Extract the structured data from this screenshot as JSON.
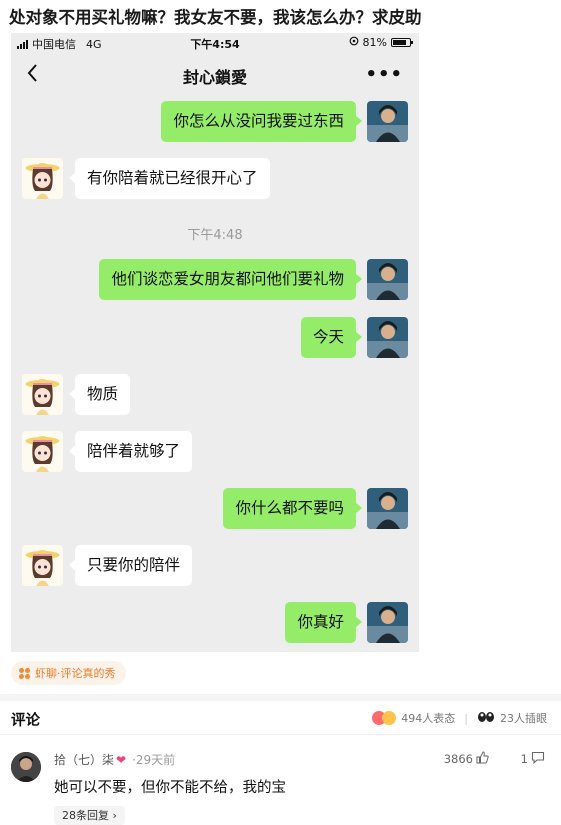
{
  "post": {
    "title": "处对象不用买礼物嘛？我女友不要，我该怎么办？求皮助"
  },
  "phone": {
    "status": {
      "carrier": "中国电信",
      "network": "4G",
      "time": "下午4:54",
      "battery": "81%",
      "battery_level": 0.81
    },
    "chat_title": "封心鎖愛",
    "messages": [
      {
        "from": "me",
        "text": "你怎么从没问我要过东西"
      },
      {
        "from": "them",
        "text": "有你陪着就已经很开心了"
      },
      {
        "from": "time",
        "text": "下午4:48"
      },
      {
        "from": "me",
        "text": "他们谈恋爱女朋友都问他们要礼物"
      },
      {
        "from": "me",
        "text": "今天"
      },
      {
        "from": "them",
        "text": "物质"
      },
      {
        "from": "them",
        "text": "陪伴着就够了"
      },
      {
        "from": "me",
        "text": "你什么都不要吗"
      },
      {
        "from": "them",
        "text": "只要你的陪伴"
      },
      {
        "from": "me",
        "text": "你真好"
      }
    ]
  },
  "tag": {
    "label": "虾聊·评论真的秀"
  },
  "comments": {
    "title": "评论",
    "reactions": "494人表态",
    "cuts_in": "23人插眼",
    "items": [
      {
        "user": "拾（七）柒",
        "time": "·29天前",
        "likes": "3866",
        "replies_count": "1",
        "text": "她可以不要，但你不能不给，我的宝",
        "replies_label": "28条回复 ›"
      }
    ]
  },
  "colors": {
    "my_bubble": "#95ec69",
    "their_bubble": "#ffffff",
    "chat_bg": "#ededed",
    "accent": "#e87d2b"
  }
}
